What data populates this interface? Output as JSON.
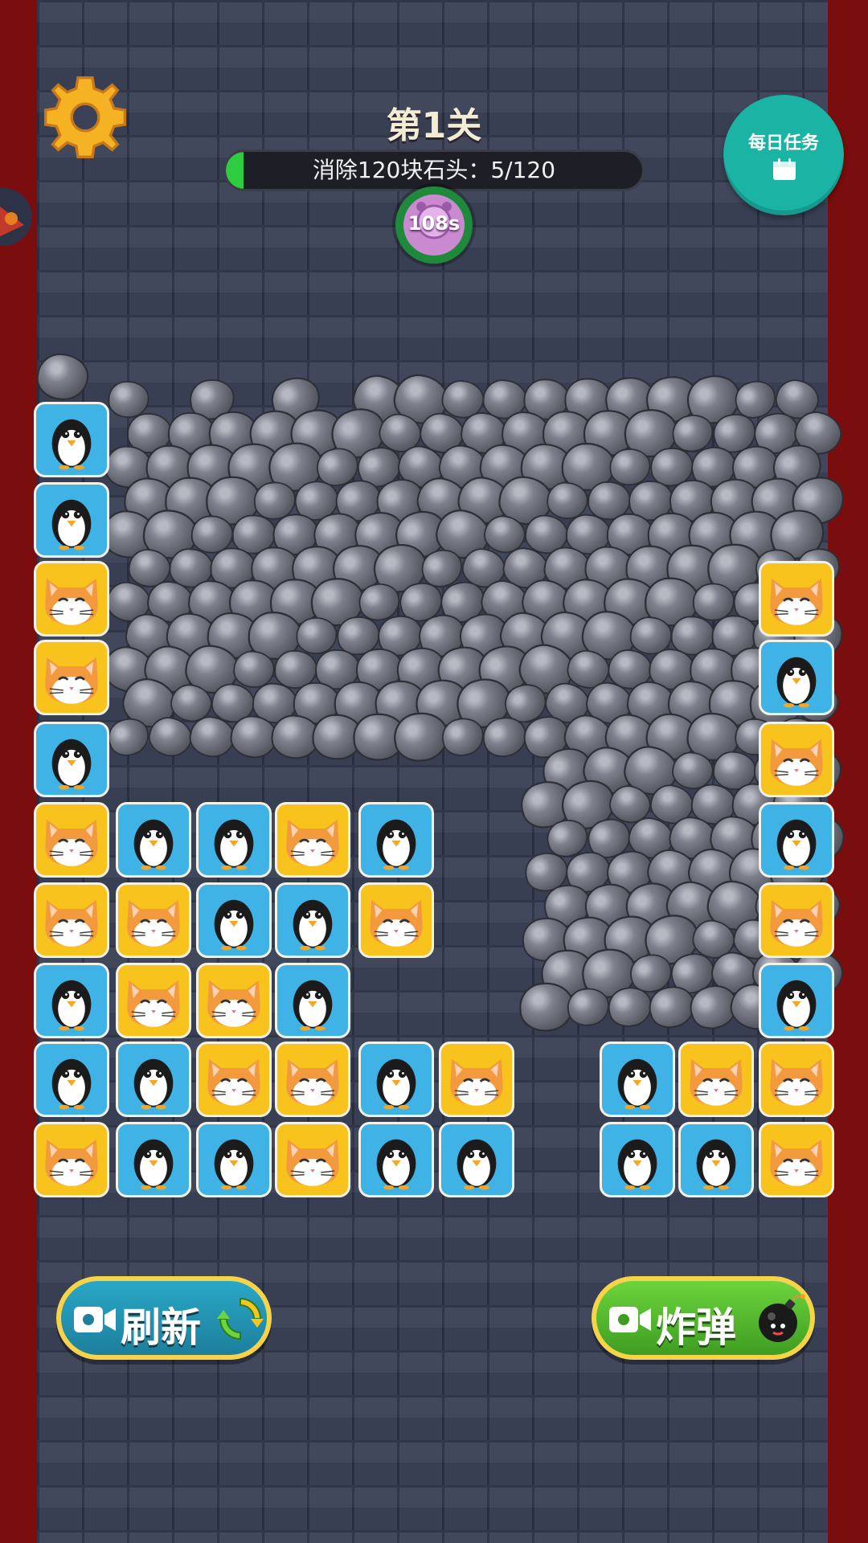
{
  "header": {
    "level_title": "第1关",
    "goal_text": "消除120块石头：5/120",
    "goal_progress": 0.0417,
    "timer_text": "108s"
  },
  "daily_task": {
    "label": "每日任务",
    "icon": "calendar-icon"
  },
  "settings": {
    "icon": "gear-icon"
  },
  "buttons": {
    "refresh_label": "刷新",
    "bomb_label": "炸弹"
  },
  "colors": {
    "progress_fill": "#2ecc40",
    "penguin_tile": "#3fb2e6",
    "cat_tile": "#f7c31c",
    "daily_button": "#1ab3a4"
  },
  "board": {
    "tile_types": [
      "penguin",
      "cat"
    ],
    "tiles": [
      {
        "col": 0,
        "row": 0,
        "type": "penguin"
      },
      {
        "col": 0,
        "row": 1,
        "type": "penguin"
      },
      {
        "col": 0,
        "row": 2,
        "type": "cat"
      },
      {
        "col": 0,
        "row": 3,
        "type": "cat"
      },
      {
        "col": 0,
        "row": 4,
        "type": "penguin"
      },
      {
        "col": 0,
        "row": 5,
        "type": "cat"
      },
      {
        "col": 0,
        "row": 6,
        "type": "cat"
      },
      {
        "col": 0,
        "row": 7,
        "type": "penguin"
      },
      {
        "col": 0,
        "row": 8,
        "type": "penguin"
      },
      {
        "col": 0,
        "row": 9,
        "type": "cat"
      },
      {
        "col": 1,
        "row": 5,
        "type": "penguin"
      },
      {
        "col": 1,
        "row": 6,
        "type": "cat"
      },
      {
        "col": 1,
        "row": 7,
        "type": "cat"
      },
      {
        "col": 1,
        "row": 8,
        "type": "penguin"
      },
      {
        "col": 1,
        "row": 9,
        "type": "penguin"
      },
      {
        "col": 2,
        "row": 5,
        "type": "penguin"
      },
      {
        "col": 2,
        "row": 6,
        "type": "penguin"
      },
      {
        "col": 2,
        "row": 7,
        "type": "cat"
      },
      {
        "col": 2,
        "row": 8,
        "type": "cat"
      },
      {
        "col": 2,
        "row": 9,
        "type": "penguin"
      },
      {
        "col": 3,
        "row": 5,
        "type": "cat"
      },
      {
        "col": 3,
        "row": 6,
        "type": "penguin"
      },
      {
        "col": 3,
        "row": 7,
        "type": "penguin"
      },
      {
        "col": 3,
        "row": 8,
        "type": "cat"
      },
      {
        "col": 3,
        "row": 9,
        "type": "cat"
      },
      {
        "col": 4,
        "row": 5,
        "type": "penguin"
      },
      {
        "col": 4,
        "row": 6,
        "type": "cat"
      },
      {
        "col": 4,
        "row": 8,
        "type": "penguin"
      },
      {
        "col": 4,
        "row": 9,
        "type": "penguin"
      },
      {
        "col": 5,
        "row": 8,
        "type": "cat"
      },
      {
        "col": 5,
        "row": 9,
        "type": "penguin"
      },
      {
        "col": 7,
        "row": 8,
        "type": "penguin"
      },
      {
        "col": 7,
        "row": 9,
        "type": "penguin"
      },
      {
        "col": 8,
        "row": 8,
        "type": "cat"
      },
      {
        "col": 8,
        "row": 9,
        "type": "penguin"
      },
      {
        "col": 9,
        "row": 2,
        "type": "cat"
      },
      {
        "col": 9,
        "row": 3,
        "type": "penguin"
      },
      {
        "col": 9,
        "row": 4,
        "type": "cat"
      },
      {
        "col": 9,
        "row": 5,
        "type": "penguin"
      },
      {
        "col": 9,
        "row": 6,
        "type": "cat"
      },
      {
        "col": 9,
        "row": 7,
        "type": "penguin"
      },
      {
        "col": 9,
        "row": 8,
        "type": "cat"
      },
      {
        "col": 9,
        "row": 9,
        "type": "cat"
      }
    ]
  }
}
